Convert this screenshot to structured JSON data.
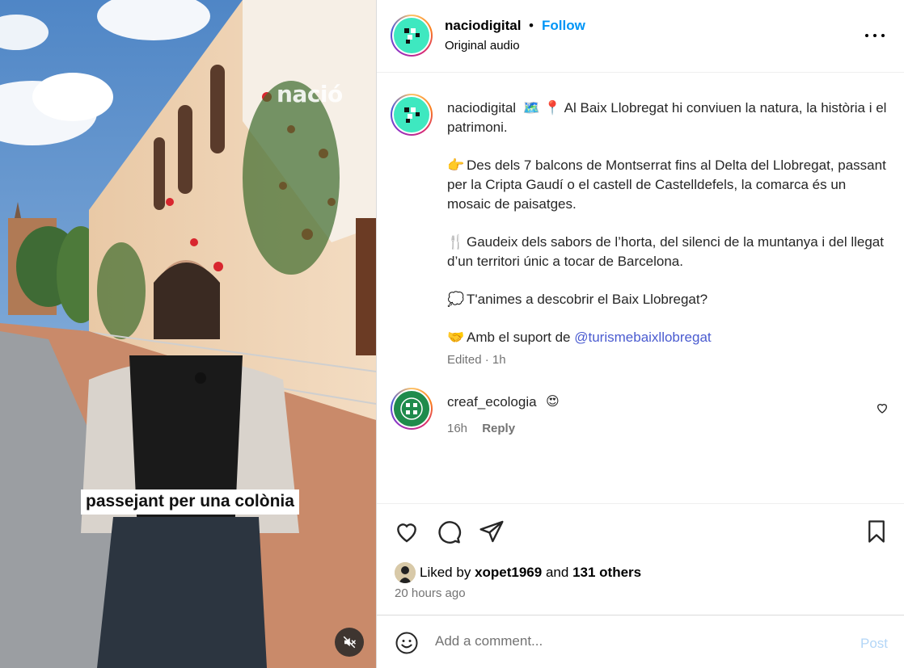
{
  "media": {
    "watermark": "nació",
    "subtitle": "passejant per una colònia",
    "mute_icon": "speaker-muted-icon"
  },
  "header": {
    "username": "naciodigital",
    "separator": "•",
    "follow_label": "Follow",
    "audio_label": "Original audio"
  },
  "caption": {
    "username": "naciodigital",
    "line1": "Al Baix Llobregat hi conviuen la natura, la història i el patrimoni.",
    "p1_emoji": "👉",
    "p1": "Des dels 7 balcons de Montserrat fins al Delta del Llobregat, passant per la Cripta Gaudí o el castell de Castelldefels, la comarca és un mosaic de paisatges.",
    "p2_emoji": "🍴",
    "p2": "Gaudeix dels sabors de l’horta, del silenci de la muntanya i del llegat d’un territori únic a tocar de Barcelona.",
    "p3_emoji": "💭",
    "p3": "T'animes a descobrir el Baix Llobregat?",
    "p4_emoji": "🤝",
    "p4_prefix": "Amb el suport de",
    "p4_mention": "@turismebaixllobregat",
    "edited": "Edited · 1h"
  },
  "comment": {
    "username": "creaf_ecologia",
    "emoji": "😍",
    "time": "16h",
    "reply_label": "Reply"
  },
  "actions": {
    "liked_by_prefix": "Liked by",
    "liked_by_user": "xopet1969",
    "and_label": "and",
    "others_label": "131 others",
    "time_ago": "20 hours ago"
  },
  "comment_bar": {
    "placeholder": "Add a comment...",
    "post_label": "Post"
  },
  "colors": {
    "follow_blue": "#0095f6",
    "post_disabled": "#b3d6f7",
    "muted_text": "#737373"
  }
}
